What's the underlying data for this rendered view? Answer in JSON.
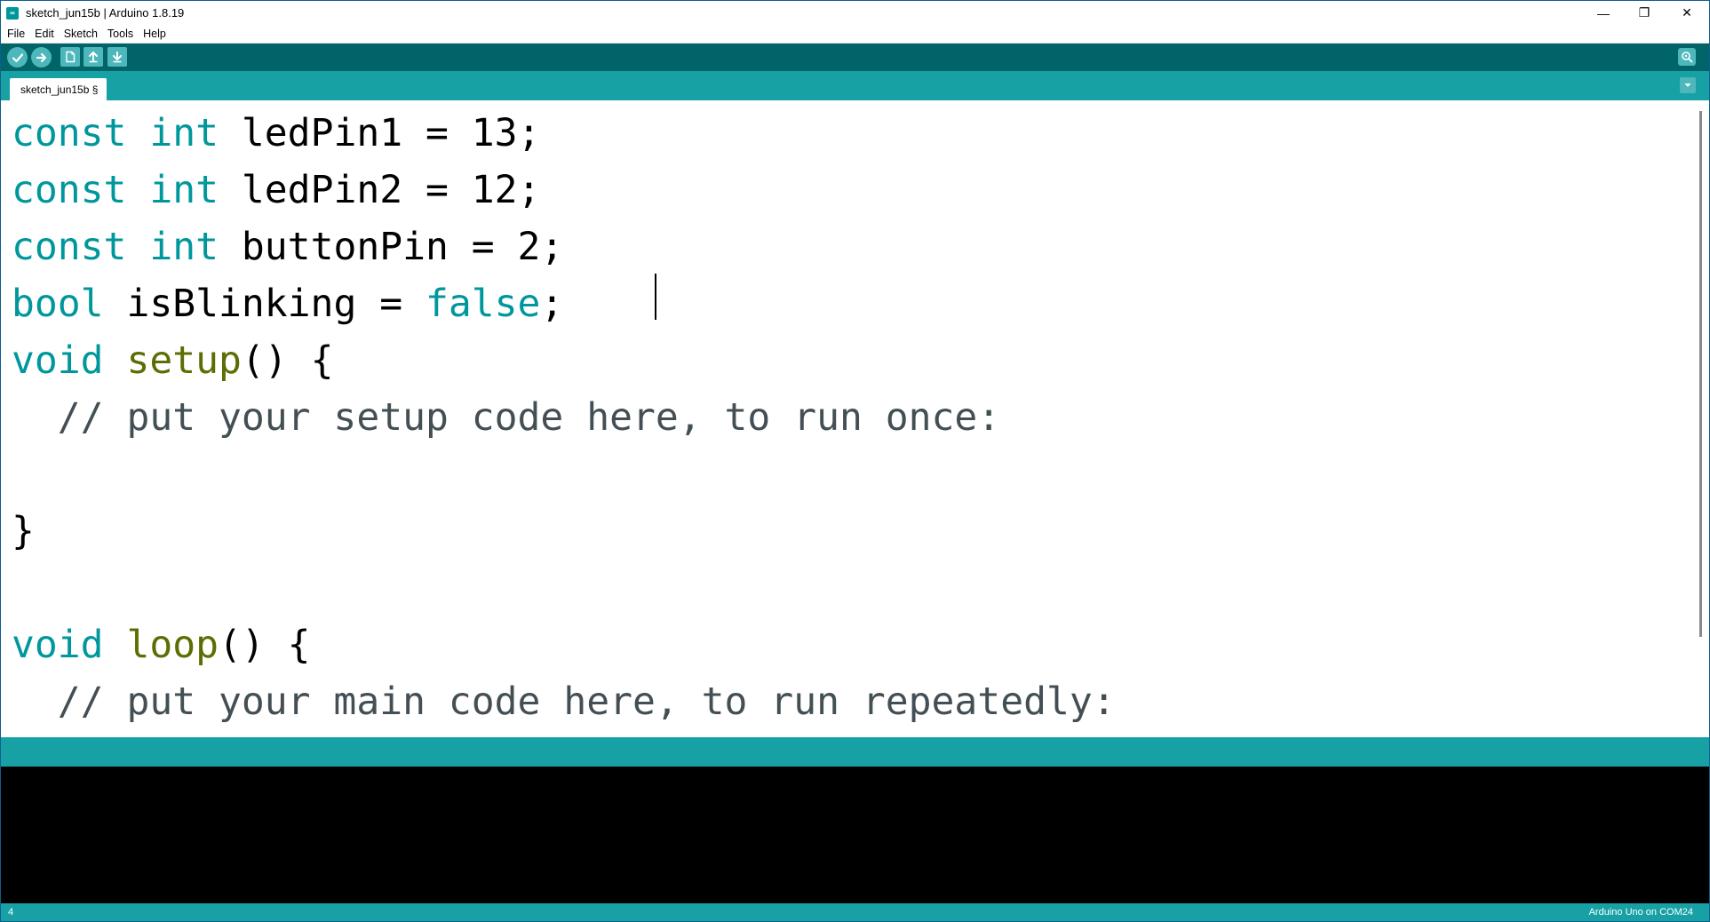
{
  "window": {
    "title": "sketch_jun15b | Arduino 1.8.19",
    "app_icon": "arduino-infinity-icon",
    "minimize_glyph": "—",
    "restore_glyph": "❐",
    "close_glyph": "✕"
  },
  "menu": {
    "items": [
      "File",
      "Edit",
      "Sketch",
      "Tools",
      "Help"
    ]
  },
  "toolbar": {
    "buttons": [
      "verify-icon",
      "upload-icon",
      "new-icon",
      "open-icon",
      "save-icon"
    ],
    "serial_monitor": "serial-monitor-icon"
  },
  "tabs": {
    "active": "sketch_jun15b §"
  },
  "editor": {
    "lines": [
      [
        {
          "t": "const",
          "c": "kw"
        },
        {
          "t": " "
        },
        {
          "t": "int",
          "c": "kw"
        },
        {
          "t": " ledPin1 = 13;"
        }
      ],
      [
        {
          "t": "const",
          "c": "kw"
        },
        {
          "t": " "
        },
        {
          "t": "int",
          "c": "kw"
        },
        {
          "t": " ledPin2 = 12;"
        }
      ],
      [
        {
          "t": "const",
          "c": "kw"
        },
        {
          "t": " "
        },
        {
          "t": "int",
          "c": "kw"
        },
        {
          "t": " buttonPin = 2;"
        }
      ],
      [
        {
          "t": "bool",
          "c": "kw"
        },
        {
          "t": " isBlinking = "
        },
        {
          "t": "false",
          "c": "kw"
        },
        {
          "t": ";"
        }
      ],
      [
        {
          "t": "void",
          "c": "kw"
        },
        {
          "t": " "
        },
        {
          "t": "setup",
          "c": "fn"
        },
        {
          "t": "() {"
        }
      ],
      [
        {
          "t": "  // put your setup code here, to run once:",
          "c": "cm"
        }
      ],
      [
        {
          "t": ""
        }
      ],
      [
        {
          "t": "}"
        }
      ],
      [
        {
          "t": ""
        }
      ],
      [
        {
          "t": "void",
          "c": "kw"
        },
        {
          "t": " "
        },
        {
          "t": "loop",
          "c": "fn"
        },
        {
          "t": "() {"
        }
      ],
      [
        {
          "t": "  // put your main code here, to run repeatedly:",
          "c": "cm"
        }
      ]
    ],
    "colors": {
      "keyword": "#00979c",
      "function": "#5e6d03",
      "comment": "#434f54"
    }
  },
  "status": {
    "line_number": "4",
    "board": "Arduino Uno on COM24"
  },
  "theme": {
    "toolbar_bg": "#006468",
    "tabbar_bg": "#17a1a5",
    "button_bg": "#4db7bb",
    "console_bg": "#000000"
  }
}
